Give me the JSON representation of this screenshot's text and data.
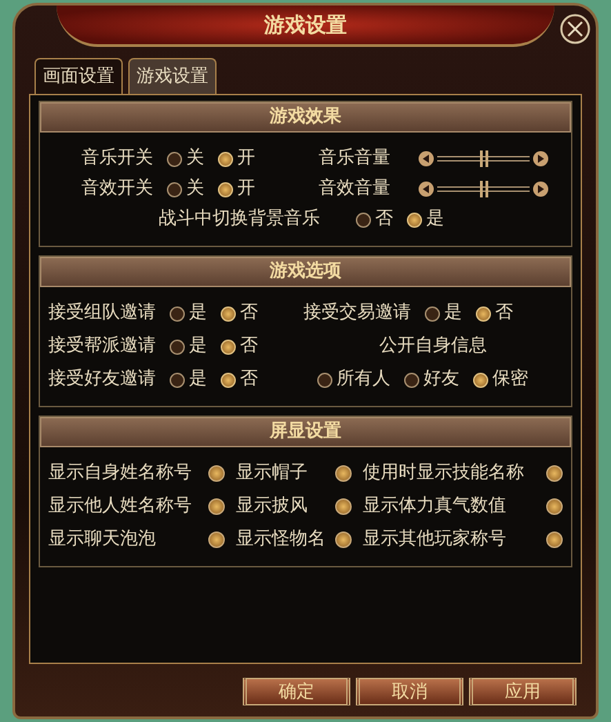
{
  "window": {
    "title": "游戏设置"
  },
  "tabs": [
    {
      "label": "画面设置",
      "selected": false
    },
    {
      "label": "游戏设置",
      "selected": true
    }
  ],
  "effects": {
    "title": "游戏效果",
    "switches": [
      {
        "label": "音乐开关",
        "options": [
          {
            "label": "关",
            "selected": false
          },
          {
            "label": "开",
            "selected": true
          }
        ],
        "volume": {
          "label": "音乐音量",
          "level": 0.5
        }
      },
      {
        "label": "音效开关",
        "options": [
          {
            "label": "关",
            "selected": false
          },
          {
            "label": "开",
            "selected": true
          }
        ],
        "volume": {
          "label": "音效音量",
          "level": 0.5
        }
      }
    ],
    "battle_music": {
      "label": "战斗中切换背景音乐",
      "options": [
        {
          "label": "否",
          "selected": false
        },
        {
          "label": "是",
          "selected": true
        }
      ]
    }
  },
  "game_options": {
    "title": "游戏选项",
    "invites": [
      {
        "label": "接受组队邀请",
        "options": [
          {
            "label": "是",
            "selected": false
          },
          {
            "label": "否",
            "selected": true
          }
        ]
      },
      {
        "label": "接受交易邀请",
        "options": [
          {
            "label": "是",
            "selected": false
          },
          {
            "label": "否",
            "selected": true
          }
        ]
      },
      {
        "label": "接受帮派邀请",
        "options": [
          {
            "label": "是",
            "selected": false
          },
          {
            "label": "否",
            "selected": true
          }
        ]
      },
      {
        "label": "接受好友邀请",
        "options": [
          {
            "label": "是",
            "selected": false
          },
          {
            "label": "否",
            "selected": true
          }
        ]
      }
    ],
    "public_info": {
      "label": "公开自身信息",
      "options": [
        {
          "label": "所有人",
          "selected": false
        },
        {
          "label": "好友",
          "selected": false
        },
        {
          "label": "保密",
          "selected": true
        }
      ]
    }
  },
  "display": {
    "title": "屏显设置",
    "items": [
      {
        "label": "显示自身姓名称号",
        "checked": true
      },
      {
        "label": "显示帽子",
        "checked": true
      },
      {
        "label": "使用时显示技能名称",
        "checked": true
      },
      {
        "label": "显示他人姓名称号",
        "checked": true
      },
      {
        "label": "显示披风",
        "checked": true
      },
      {
        "label": "显示体力真气数值",
        "checked": true
      },
      {
        "label": "显示聊天泡泡",
        "checked": true
      },
      {
        "label": "显示怪物名",
        "checked": true
      },
      {
        "label": "显示其他玩家称号",
        "checked": true
      }
    ]
  },
  "buttons": [
    "确定",
    "取消",
    "应用"
  ]
}
